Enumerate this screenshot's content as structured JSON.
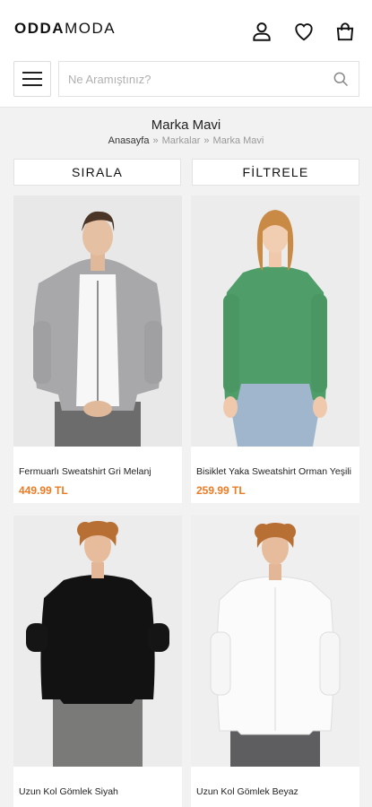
{
  "brand": {
    "bold_part": "ODDA",
    "light_part": "MODA"
  },
  "header_icons": [
    "user-icon",
    "heart-icon",
    "shopping-bag-icon"
  ],
  "search": {
    "placeholder": "Ne Aramıştınız?",
    "value": ""
  },
  "page": {
    "title": "Marka Mavi",
    "breadcrumb": [
      "Anasayfa",
      "Markalar",
      "Marka Mavi"
    ]
  },
  "toolbar": {
    "sort_label": "SIRALA",
    "filter_label": "FİLTRELE"
  },
  "products": [
    {
      "name": "Fermuarlı Sweatshirt Gri Melanj",
      "price": "449.99 TL"
    },
    {
      "name": "Bisiklet Yaka Sweatshirt Orman Yeşili",
      "price": "259.99 TL"
    },
    {
      "name": "Uzun Kol Gömlek Siyah",
      "price": ""
    },
    {
      "name": "Uzun Kol Gömlek Beyaz",
      "price": ""
    }
  ],
  "colors": {
    "accent_price": "#f07a22",
    "background": "#f2f2f2"
  }
}
